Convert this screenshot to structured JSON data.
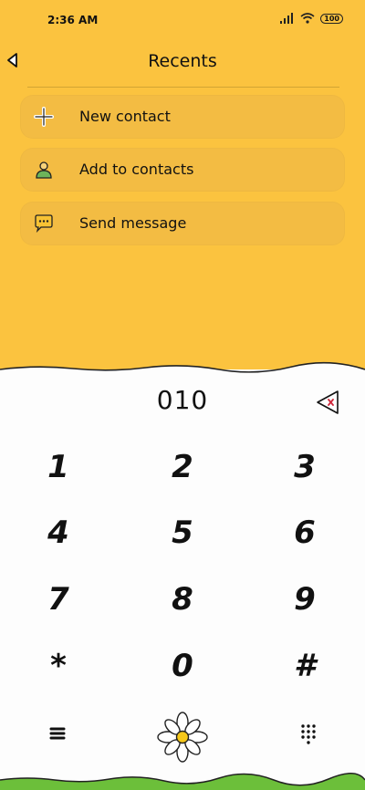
{
  "status": {
    "time": "2:36 AM",
    "battery": "100"
  },
  "header": {
    "title": "Recents"
  },
  "actions": [
    {
      "label": "New contact",
      "icon": "add-contact-icon"
    },
    {
      "label": "Add to contacts",
      "icon": "person-icon"
    },
    {
      "label": "Send message",
      "icon": "message-icon"
    }
  ],
  "dialer": {
    "number": "010"
  },
  "keypad": [
    "1",
    "2",
    "3",
    "4",
    "5",
    "6",
    "7",
    "8",
    "9",
    "*",
    "0",
    "#"
  ],
  "colors": {
    "top": "#fbc33f",
    "action_bg": "#f3bc43",
    "pad_bg": "#fdfdfd",
    "grass": "#6cbf3a"
  }
}
